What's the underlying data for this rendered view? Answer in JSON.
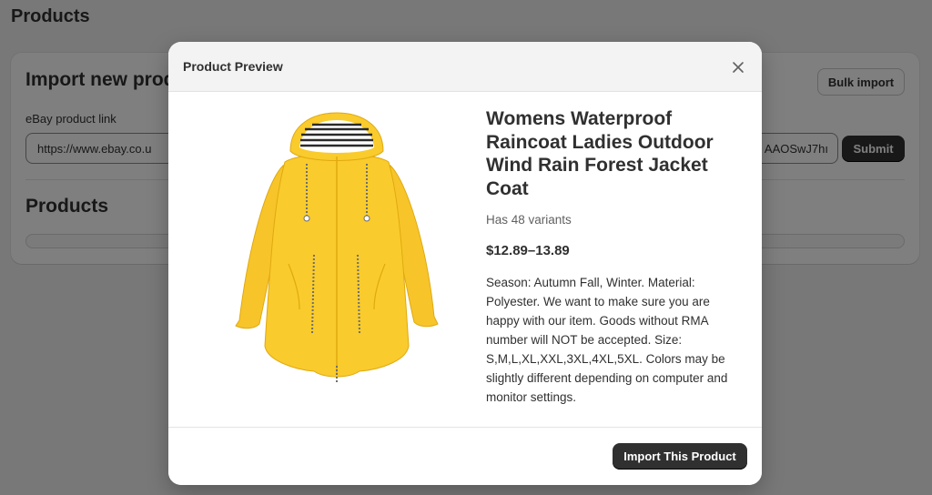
{
  "page": {
    "title": "Products"
  },
  "import_card": {
    "heading": "Import new products",
    "bulk_import_label": "Bulk import",
    "link_label": "eBay product link",
    "link_value_start": "https://www.ebay.co.u",
    "link_value_end": "AAOSwJ7hı",
    "submit_label": "Submit"
  },
  "products_section": {
    "heading": "Products",
    "progress_fraction": 0.0
  },
  "modal": {
    "title": "Product Preview",
    "close_icon": "close-icon",
    "product": {
      "image_icon": "yellow-raincoat-image",
      "title": "Womens Waterproof Raincoat Ladies Outdoor Wind Rain Forest Jacket Coat",
      "variants_text": "Has 48 variants",
      "price": "$12.89–13.89",
      "description": "Season: Autumn Fall, Winter. Material: Polyester. We want to make sure you are happy with our item. Goods without RMA number will NOT be accepted. Size: S,M,L,XL,XXL,3XL,4XL,5XL. Colors may be slightly different depending on computer and monitor settings."
    },
    "import_button_label": "Import This Product"
  },
  "colors": {
    "primary_button": "#303030",
    "overlay": "rgba(0,0,0,0.5)",
    "coat_yellow": "#f9cb2c"
  }
}
